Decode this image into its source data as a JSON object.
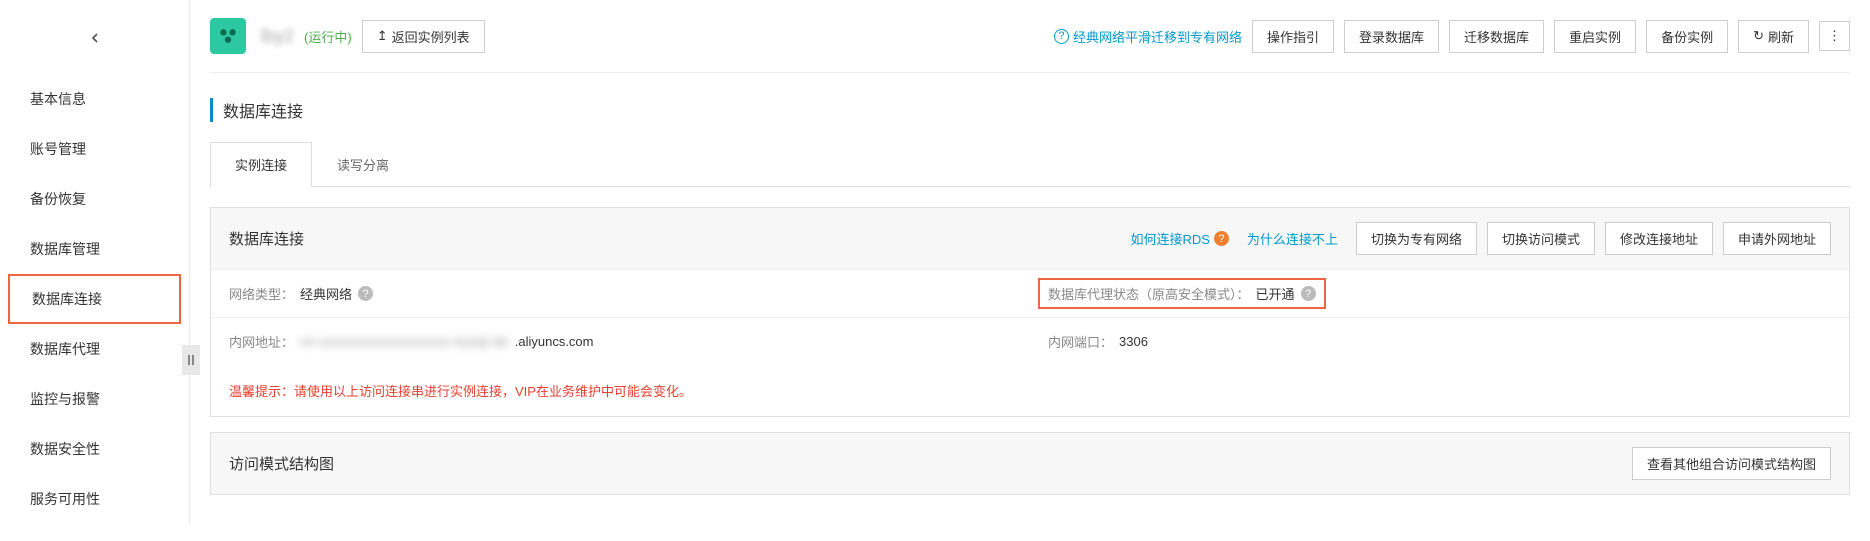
{
  "sidebar": {
    "items": [
      "基本信息",
      "账号管理",
      "备份恢复",
      "数据库管理",
      "数据库连接",
      "数据库代理",
      "监控与报警",
      "数据安全性",
      "服务可用性"
    ],
    "activeIndex": 4
  },
  "header": {
    "instance": "lby2",
    "status": "(运行中)",
    "backBtn": "返回实例列表",
    "migrateLink": "经典网络平滑迁移到专有网络",
    "actions": [
      "操作指引",
      "登录数据库",
      "迁移数据库",
      "重启实例",
      "备份实例"
    ],
    "refresh": "刷新"
  },
  "sectionTitle": "数据库连接",
  "tabs": [
    "实例连接",
    "读写分离"
  ],
  "panel": {
    "title": "数据库连接",
    "links": {
      "howConnect": "如何连接RDS",
      "whyFail": "为什么连接不上",
      "actions": [
        "切换为专有网络",
        "切换访问模式",
        "修改连接地址",
        "申请外网地址"
      ]
    },
    "row1": {
      "netTypeLabel": "网络类型：",
      "netTypeVal": "经典网络",
      "proxyLabel": "数据库代理状态（原高安全模式）：",
      "proxyVal": "已开通"
    },
    "row2": {
      "intranetLabel": "内网地址：",
      "intranetVal": "rm-xxxxxxxxxxxxxxxxxxxx.mysql.rds",
      "intranetSuffix": ".aliyuncs.com",
      "portLabel": "内网端口：",
      "portVal": "3306"
    },
    "warning": "温馨提示：请使用以上访问连接串进行实例连接，VIP在业务维护中可能会变化。"
  },
  "panel2": {
    "title": "访问模式结构图",
    "btn": "查看其他组合访问模式结构图"
  }
}
